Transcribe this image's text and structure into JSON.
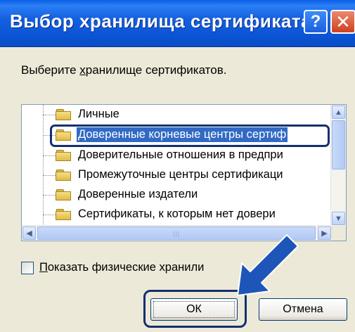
{
  "window": {
    "title": "Выбор хранилища сертификата",
    "help_label": "?",
    "close_label": "✕"
  },
  "instruction": {
    "prefix": "Выберите ",
    "underlined": "х",
    "suffix": "ранилище сертификатов."
  },
  "tree": {
    "items": [
      {
        "label": "Личные",
        "selected": false
      },
      {
        "label": "Доверенные корневые центры сертиф",
        "selected": true
      },
      {
        "label": "Доверительные отношения в предпри",
        "selected": false
      },
      {
        "label": "Промежуточные центры сертификаци",
        "selected": false
      },
      {
        "label": "Доверенные издатели",
        "selected": false
      },
      {
        "label": "Сертификаты, к которым нет довери",
        "selected": false
      }
    ],
    "scroll_up_glyph": "▲",
    "scroll_down_glyph": "▼",
    "scroll_left_glyph": "◀",
    "scroll_right_glyph": "▶",
    "hthumb_grip": "|||"
  },
  "checkbox": {
    "checked": false,
    "underlined": "П",
    "label_rest": "оказать физические хранили"
  },
  "buttons": {
    "ok": "ОК",
    "cancel": "Отмена"
  },
  "colors": {
    "titlebar": "#0A5FE6",
    "selection": "#316AC5",
    "annotation": "#13306E",
    "arrow": "#1D56B8",
    "dialog_bg": "#ECE9D8"
  }
}
